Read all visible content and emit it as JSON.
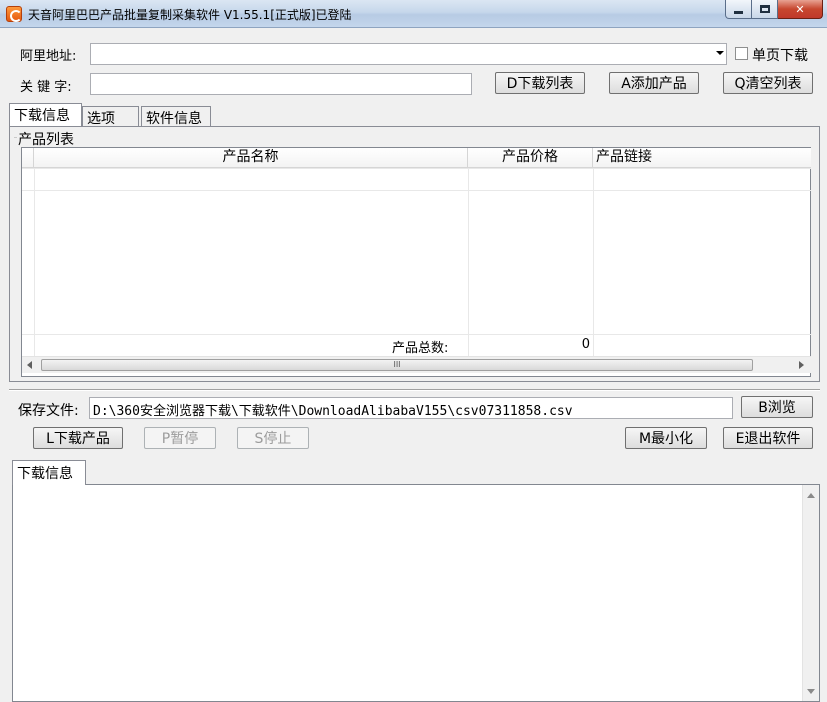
{
  "window": {
    "title": "天音阿里巴巴产品批量复制采集软件 V1.55.1[正式版]已登陆",
    "icon": "app-logo-icon"
  },
  "top_form": {
    "url_label": "阿里地址:",
    "url_value": "",
    "single_page_label": "单页下载",
    "keyword_label": "关 键 字:",
    "keyword_value": "",
    "download_list_button": "D下载列表",
    "add_product_button": "A添加产品",
    "clear_list_button": "Q清空列表"
  },
  "tabs": [
    {
      "label": "下载信息",
      "active": true
    },
    {
      "label": "选项",
      "active": false
    },
    {
      "label": "软件信息",
      "active": false
    }
  ],
  "product_list": {
    "group_label": "产品列表",
    "columns": [
      "产品名称",
      "产品价格",
      "产品链接"
    ],
    "rows": [],
    "total_label": "产品总数:",
    "total_value": "0",
    "scroll_thumb": "III"
  },
  "save": {
    "label": "保存文件:",
    "path": "D:\\360安全浏览器下载\\下载软件\\DownloadAlibabaV155\\csv07311858.csv",
    "browse_button": "B浏览"
  },
  "actions": {
    "download_button": "L下载产品",
    "pause_button": "P暂停",
    "stop_button": "S停止",
    "minimize_button": "M最小化",
    "exit_button": "E退出软件"
  },
  "log": {
    "tab_label": "下载信息",
    "content": ""
  },
  "colors": {
    "title_bar": "#c6d7eb",
    "close_button": "#c7472f",
    "window_bg": "#f0f0f0"
  }
}
